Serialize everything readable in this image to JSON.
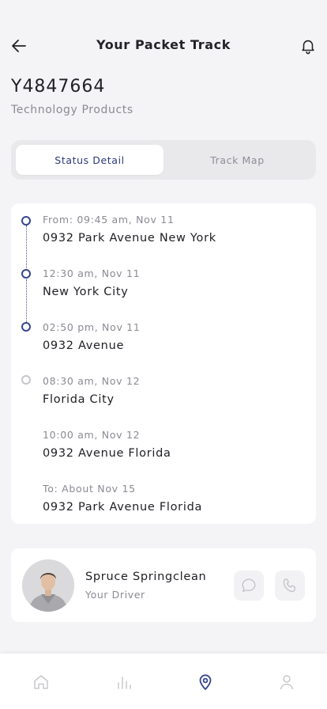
{
  "header": {
    "title": "Your Packet Track"
  },
  "package": {
    "id": "Y4847664",
    "category": "Technology Products"
  },
  "tabs": [
    {
      "label": "Status Detail",
      "active": true
    },
    {
      "label": "Track Map",
      "active": false
    }
  ],
  "timeline": [
    {
      "time": "From: 09:45 am, Nov 11",
      "place": "0932 Park Avenue New York",
      "state": "done"
    },
    {
      "time": "12:30 am, Nov 11",
      "place": "New York City",
      "state": "done"
    },
    {
      "time": "02:50 pm, Nov 11",
      "place": "0932 Avenue",
      "state": "done"
    },
    {
      "time": "08:30 am, Nov 12",
      "place": "Florida City",
      "state": "pending"
    },
    {
      "time": "10:00 am, Nov 12",
      "place": "0932 Avenue Florida",
      "state": "none"
    },
    {
      "time": "To: About Nov 15",
      "place": "0932 Park Avenue Florida",
      "state": "none"
    }
  ],
  "driver": {
    "name": "Spruce Springclean",
    "role": "Your Driver"
  },
  "nav": [
    {
      "icon": "home-icon",
      "active": false
    },
    {
      "icon": "stats-icon",
      "active": false
    },
    {
      "icon": "location-pin-icon",
      "active": true
    },
    {
      "icon": "profile-icon",
      "active": false
    }
  ],
  "colors": {
    "accent": "#354590",
    "inactive": "#c6c6cc",
    "muted_text": "#8a8a93"
  }
}
